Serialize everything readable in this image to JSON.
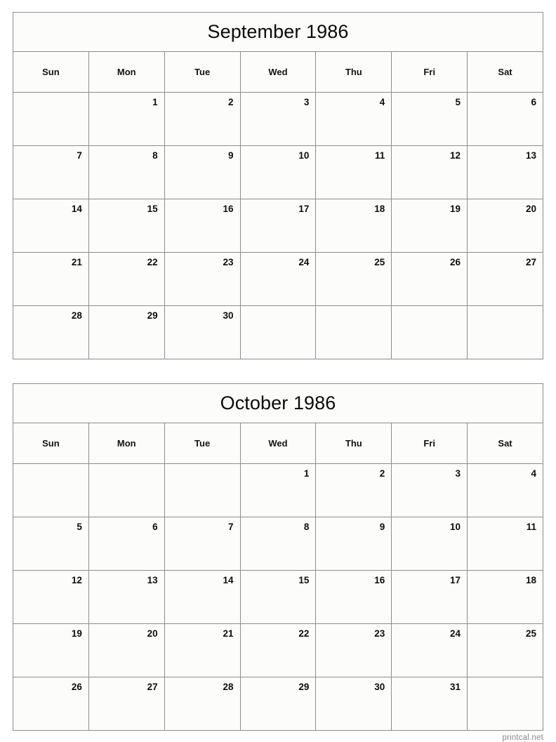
{
  "page": {
    "background_color": "#ffffff",
    "border_color": "#8d8d8d",
    "cell_background": "#fcfdfa"
  },
  "footer": {
    "label": "printcal.net"
  },
  "weekday_headers": [
    "Sun",
    "Mon",
    "Tue",
    "Wed",
    "Thu",
    "Fri",
    "Sat"
  ],
  "calendars": [
    {
      "title": "September 1986",
      "month": "September",
      "year": "1986",
      "weeks": [
        [
          "",
          "1",
          "2",
          "3",
          "4",
          "5",
          "6"
        ],
        [
          "7",
          "8",
          "9",
          "10",
          "11",
          "12",
          "13"
        ],
        [
          "14",
          "15",
          "16",
          "17",
          "18",
          "19",
          "20"
        ],
        [
          "21",
          "22",
          "23",
          "24",
          "25",
          "26",
          "27"
        ],
        [
          "28",
          "29",
          "30",
          "",
          "",
          "",
          ""
        ]
      ]
    },
    {
      "title": "October 1986",
      "month": "October",
      "year": "1986",
      "weeks": [
        [
          "",
          "",
          "",
          "1",
          "2",
          "3",
          "4"
        ],
        [
          "5",
          "6",
          "7",
          "8",
          "9",
          "10",
          "11"
        ],
        [
          "12",
          "13",
          "14",
          "15",
          "16",
          "17",
          "18"
        ],
        [
          "19",
          "20",
          "21",
          "22",
          "23",
          "24",
          "25"
        ],
        [
          "26",
          "27",
          "28",
          "29",
          "30",
          "31",
          ""
        ]
      ]
    }
  ]
}
